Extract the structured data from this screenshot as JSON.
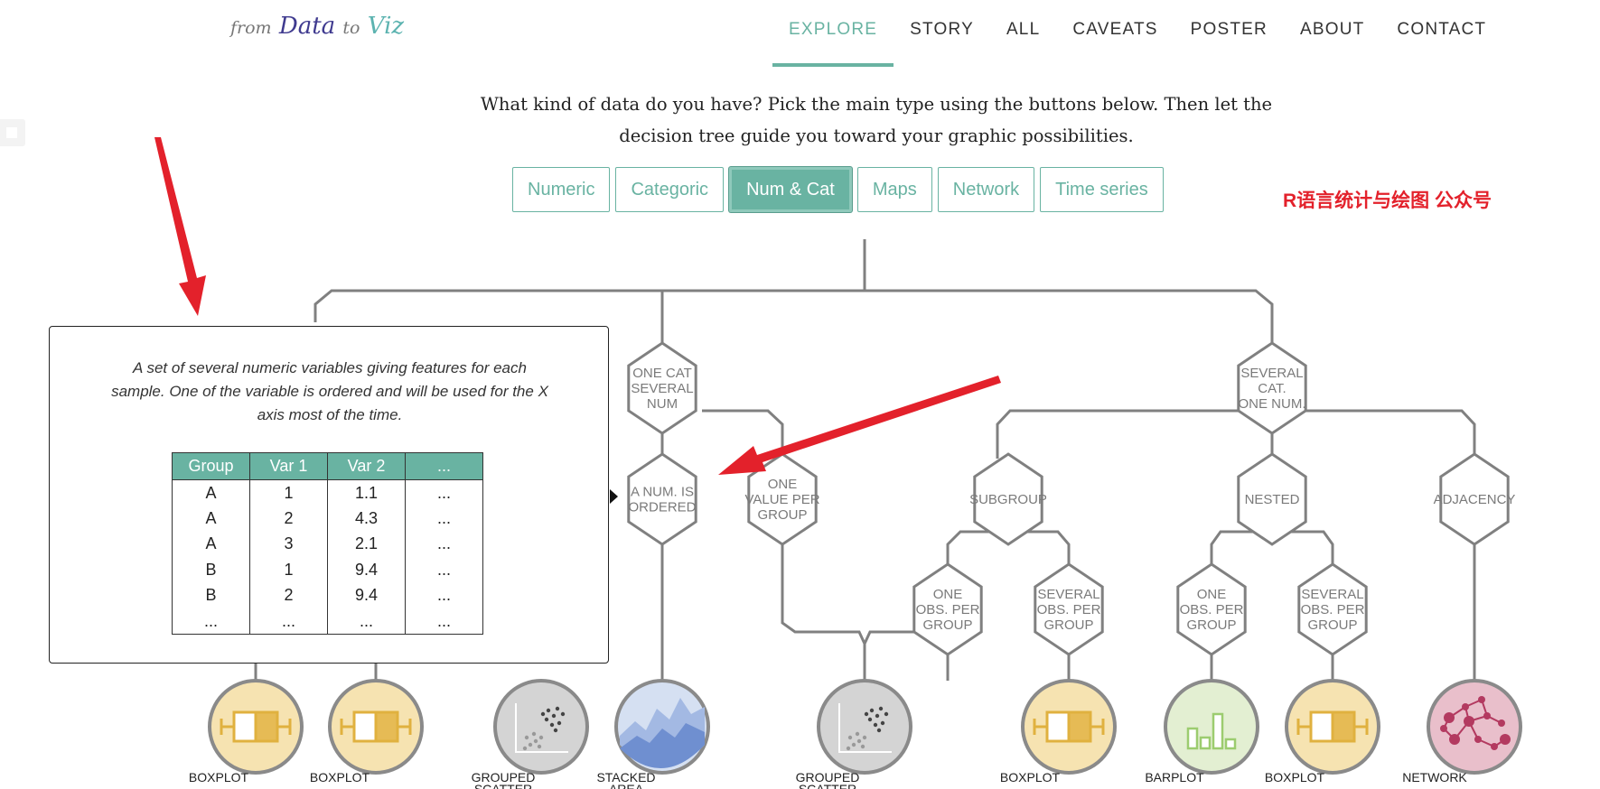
{
  "logo": {
    "from": "from",
    "data": "Data",
    "to": "to",
    "viz": "Viz"
  },
  "nav": [
    "EXPLORE",
    "STORY",
    "ALL",
    "CAVEATS",
    "POSTER",
    "ABOUT",
    "CONTACT"
  ],
  "intro": "What kind of data do you have? Pick the main type using the buttons below. Then let the decision tree guide you toward your graphic possibilities.",
  "type_buttons": [
    "Numeric",
    "Categoric",
    "Num & Cat",
    "Maps",
    "Network",
    "Time series"
  ],
  "active_type": "Num & Cat",
  "watermark": "R语言统计与绘图 公众号",
  "tree": {
    "nodes": {
      "one_cat": [
        "ONE CAT",
        "SEVERAL",
        "NUM"
      ],
      "several_cat": [
        "SEVERAL",
        "CAT.",
        "ONE NUM."
      ],
      "num_ordered": [
        "A NUM. IS",
        "ORDERED"
      ],
      "one_value": [
        "ONE",
        "VALUE PER",
        "GROUP"
      ],
      "subgroup": [
        "SUBGROUP"
      ],
      "nested": [
        "NESTED"
      ],
      "adjacency": [
        "ADJACENCY"
      ],
      "sub_one_obs": [
        "ONE",
        "OBS. PER",
        "GROUP"
      ],
      "sub_several_obs": [
        "SEVERAL",
        "OBS. PER",
        "GROUP"
      ],
      "nest_one_obs": [
        "ONE",
        "OBS. PER",
        "GROUP"
      ],
      "nest_several_obs": [
        "SEVERAL",
        "OBS. PER",
        "GROUP"
      ]
    },
    "leaves": [
      {
        "label": [
          "BOXPLOT"
        ],
        "icon": "boxplot-icon"
      },
      {
        "label": [
          "BOXPLOT"
        ],
        "icon": "boxplot-icon"
      },
      {
        "label": [
          "GROUPED",
          "SCATTER"
        ],
        "icon": "scatter-icon"
      },
      {
        "label": [
          "STACKED",
          "AREA"
        ],
        "icon": "stacked-area-icon"
      },
      {
        "label": [
          "GROUPED",
          "SCATTER"
        ],
        "icon": "scatter-icon"
      },
      {
        "label": [
          "BOXPLOT"
        ],
        "icon": "boxplot-icon"
      },
      {
        "label": [
          "BARPLOT"
        ],
        "icon": "barplot-icon"
      },
      {
        "label": [
          "BOXPLOT"
        ],
        "icon": "boxplot-icon"
      },
      {
        "label": [
          "NETWORK"
        ],
        "icon": "network-icon"
      }
    ]
  },
  "tooltip": {
    "description": "A set of several numeric variables giving features for each sample. One of the variable is ordered and will be used for the X axis most of the time.",
    "columns": [
      "Group",
      "Var 1",
      "Var 2",
      "..."
    ],
    "rows": [
      [
        "A",
        "1",
        "1.1",
        "..."
      ],
      [
        "A",
        "2",
        "4.3",
        "..."
      ],
      [
        "A",
        "3",
        "2.1",
        "..."
      ],
      [
        "B",
        "1",
        "9.4",
        "..."
      ],
      [
        "B",
        "2",
        "9.4",
        "..."
      ],
      [
        "...",
        "...",
        "...",
        "..."
      ]
    ]
  },
  "colors": {
    "accent": "#69b3a2",
    "annotation_arrow": "#e3212b",
    "watermark": "#e3212b"
  }
}
